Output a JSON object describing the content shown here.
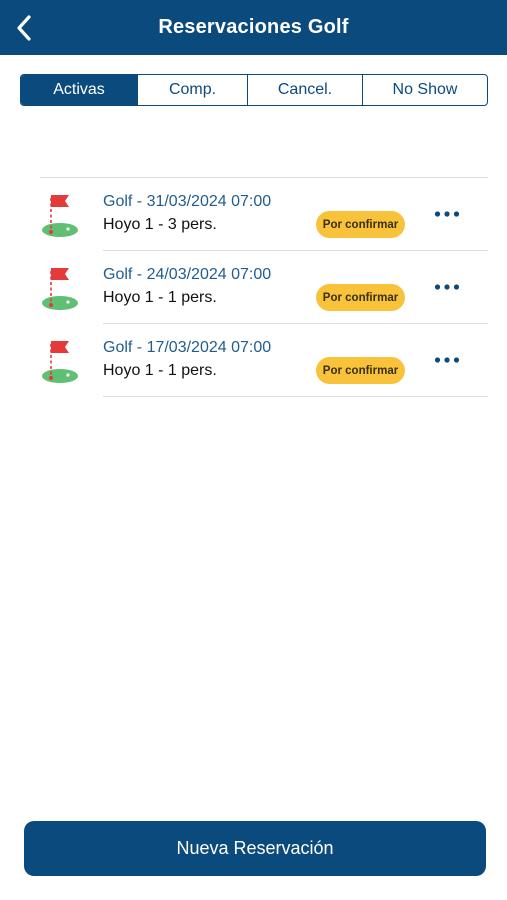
{
  "header": {
    "title": "Reservaciones Golf",
    "back_icon": "chevron-left-icon"
  },
  "tabs": [
    {
      "label": "Activas",
      "active": true
    },
    {
      "label": "Comp.",
      "active": false
    },
    {
      "label": "Cancel.",
      "active": false
    },
    {
      "label": "No Show",
      "active": false
    }
  ],
  "reservations": [
    {
      "title": "Golf - 31/03/2024 07:00",
      "detail": "Hoyo 1 - 3 pers.",
      "status": "Por confirmar",
      "icon": "golf-flag-icon"
    },
    {
      "title": "Golf - 24/03/2024 07:00",
      "detail": "Hoyo 1 - 1 pers.",
      "status": "Por confirmar",
      "icon": "golf-flag-icon"
    },
    {
      "title": "Golf - 17/03/2024 07:00",
      "detail": "Hoyo 1 - 1 pers.",
      "status": "Por confirmar",
      "icon": "golf-flag-icon"
    }
  ],
  "new_reservation_label": "Nueva Reservación",
  "colors": {
    "primary": "#0b4a7d",
    "link_text": "#1f5d8f",
    "badge": "#f8c33a",
    "flag_red": "#e53a3a",
    "green": "#5fbf73"
  }
}
